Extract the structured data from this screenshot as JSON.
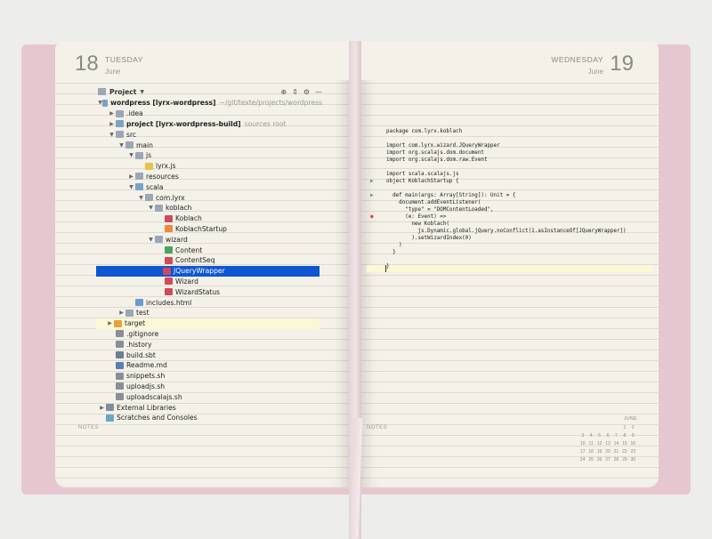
{
  "left_page": {
    "day_number": "18",
    "weekday": "TUESDAY",
    "month": "June",
    "notes_label": "NOTES"
  },
  "right_page": {
    "day_number": "19",
    "weekday": "WEDNESDAY",
    "month": "June",
    "notes_label": "NOTES"
  },
  "project_tool": {
    "title": "Project",
    "dropdown_icon": "chevron-down-icon",
    "tool_icons": [
      "target-icon",
      "collapse-icon",
      "gear-icon",
      "minimize-icon"
    ]
  },
  "tree": [
    {
      "label": "wordpress [lyrx-wordpress]",
      "hint": "~/git/texte/projects/wordpress",
      "level": 0,
      "arrow": "▼",
      "icon": "module-folder",
      "bold": true
    },
    {
      "label": ".idea",
      "hint": "",
      "level": 1,
      "arrow": "▶",
      "icon": "folder"
    },
    {
      "label": "project [lyrx-wordpress-build]",
      "hint": "sources root",
      "level": 1,
      "arrow": "▶",
      "icon": "folder-src",
      "bold": true
    },
    {
      "label": "src",
      "hint": "",
      "level": 1,
      "arrow": "▼",
      "icon": "folder"
    },
    {
      "label": "main",
      "hint": "",
      "level": 2,
      "arrow": "▼",
      "icon": "folder"
    },
    {
      "label": "js",
      "hint": "",
      "level": 3,
      "arrow": "▼",
      "icon": "folder"
    },
    {
      "label": "lyrx.js",
      "hint": "",
      "level": 4,
      "arrow": "",
      "icon": "file-js"
    },
    {
      "label": "resources",
      "hint": "",
      "level": 3,
      "arrow": "▶",
      "icon": "folder"
    },
    {
      "label": "scala",
      "hint": "",
      "level": 3,
      "arrow": "▼",
      "icon": "folder-src"
    },
    {
      "label": "com.lyrx",
      "hint": "",
      "level": 4,
      "arrow": "▼",
      "icon": "folder"
    },
    {
      "label": "koblach",
      "hint": "",
      "level": 5,
      "arrow": "▼",
      "icon": "folder"
    },
    {
      "label": "Koblach",
      "hint": "",
      "level": 6,
      "arrow": "",
      "icon": "file-scala"
    },
    {
      "label": "KoblachStartup",
      "hint": "",
      "level": 6,
      "arrow": "",
      "icon": "file-obj"
    },
    {
      "label": "wizard",
      "hint": "",
      "level": 5,
      "arrow": "▼",
      "icon": "folder"
    },
    {
      "label": "Content",
      "hint": "",
      "level": 6,
      "arrow": "",
      "icon": "file-trait"
    },
    {
      "label": "ContentSeq",
      "hint": "",
      "level": 6,
      "arrow": "",
      "icon": "file-scala"
    },
    {
      "label": "JQueryWrapper",
      "hint": "",
      "level": 6,
      "arrow": "",
      "icon": "file-scala",
      "selected": true
    },
    {
      "label": "Wizard",
      "hint": "",
      "level": 6,
      "arrow": "",
      "icon": "file-scala"
    },
    {
      "label": "WizardStatus",
      "hint": "",
      "level": 6,
      "arrow": "",
      "icon": "file-scala"
    },
    {
      "label": "includes.html",
      "hint": "",
      "level": 3,
      "arrow": "",
      "icon": "file-html"
    },
    {
      "label": "test",
      "hint": "",
      "level": 2,
      "arrow": "▶",
      "icon": "folder"
    },
    {
      "label": "target",
      "hint": "",
      "level": 1,
      "arrow": "▶",
      "icon": "folder-orange",
      "highlight": true
    },
    {
      "label": ".gitignore",
      "hint": "",
      "level": 1,
      "arrow": "",
      "icon": "file-sh"
    },
    {
      "label": ".history",
      "hint": "",
      "level": 1,
      "arrow": "",
      "icon": "file-sh"
    },
    {
      "label": "build.sbt",
      "hint": "",
      "level": 1,
      "arrow": "",
      "icon": "file-sbt"
    },
    {
      "label": "Readme.md",
      "hint": "",
      "level": 1,
      "arrow": "",
      "icon": "file-md"
    },
    {
      "label": "snippets.sh",
      "hint": "",
      "level": 1,
      "arrow": "",
      "icon": "file-sh"
    },
    {
      "label": "uploadjs.sh",
      "hint": "",
      "level": 1,
      "arrow": "",
      "icon": "file-sh"
    },
    {
      "label": "uploadscalajs.sh",
      "hint": "",
      "level": 1,
      "arrow": "",
      "icon": "file-sh"
    },
    {
      "label": "External Libraries",
      "hint": "",
      "level": 0,
      "arrow": "▶",
      "icon": "file-lib"
    },
    {
      "label": "Scratches and Consoles",
      "hint": "",
      "level": 0,
      "arrow": "",
      "icon": "file-scratch"
    }
  ],
  "code": [
    {
      "text": "package com.lyrx.koblach",
      "gutter": ""
    },
    {
      "text": "",
      "gutter": ""
    },
    {
      "text": "import com.lyrx.wizard.JQueryWrapper",
      "gutter": ""
    },
    {
      "text": "import org.scalajs.dom.document",
      "gutter": ""
    },
    {
      "text": "import org.scalajs.dom.raw.Event",
      "gutter": ""
    },
    {
      "text": "",
      "gutter": ""
    },
    {
      "text": "import scala.scalajs.js",
      "gutter": ""
    },
    {
      "text": "object KoblachStartup {",
      "gutter": "▶"
    },
    {
      "text": "",
      "gutter": ""
    },
    {
      "text": "  def main(args: Array[String]): Unit = {",
      "gutter": "▶"
    },
    {
      "text": "    document.addEventListener(",
      "gutter": ""
    },
    {
      "text": "      \"type\" = \"DOMContentLoaded\",",
      "gutter": ""
    },
    {
      "text": "      (e: Event) =>",
      "gutter": "●"
    },
    {
      "text": "        new Koblach(",
      "gutter": ""
    },
    {
      "text": "          js.Dynamic.global.jQuery.noConflict(1.asInstanceOf[JQueryWrapper])",
      "gutter": ""
    },
    {
      "text": "        ).setWizardIndex(0)",
      "gutter": ""
    },
    {
      "text": "    )",
      "gutter": ""
    },
    {
      "text": "  }",
      "gutter": ""
    },
    {
      "text": "",
      "gutter": ""
    },
    {
      "text": "}",
      "gutter": ""
    }
  ],
  "mini_calendar": {
    "title": "JUNE",
    "weekdays": [
      "",
      "",
      "",
      "",
      "",
      "1",
      "2"
    ],
    "days": [
      "3",
      "4",
      "5",
      "6",
      "7",
      "8",
      "9",
      "10",
      "11",
      "12",
      "13",
      "14",
      "15",
      "16",
      "17",
      "18",
      "19",
      "20",
      "21",
      "22",
      "23",
      "24",
      "25",
      "26",
      "27",
      "28",
      "29",
      "30"
    ]
  }
}
